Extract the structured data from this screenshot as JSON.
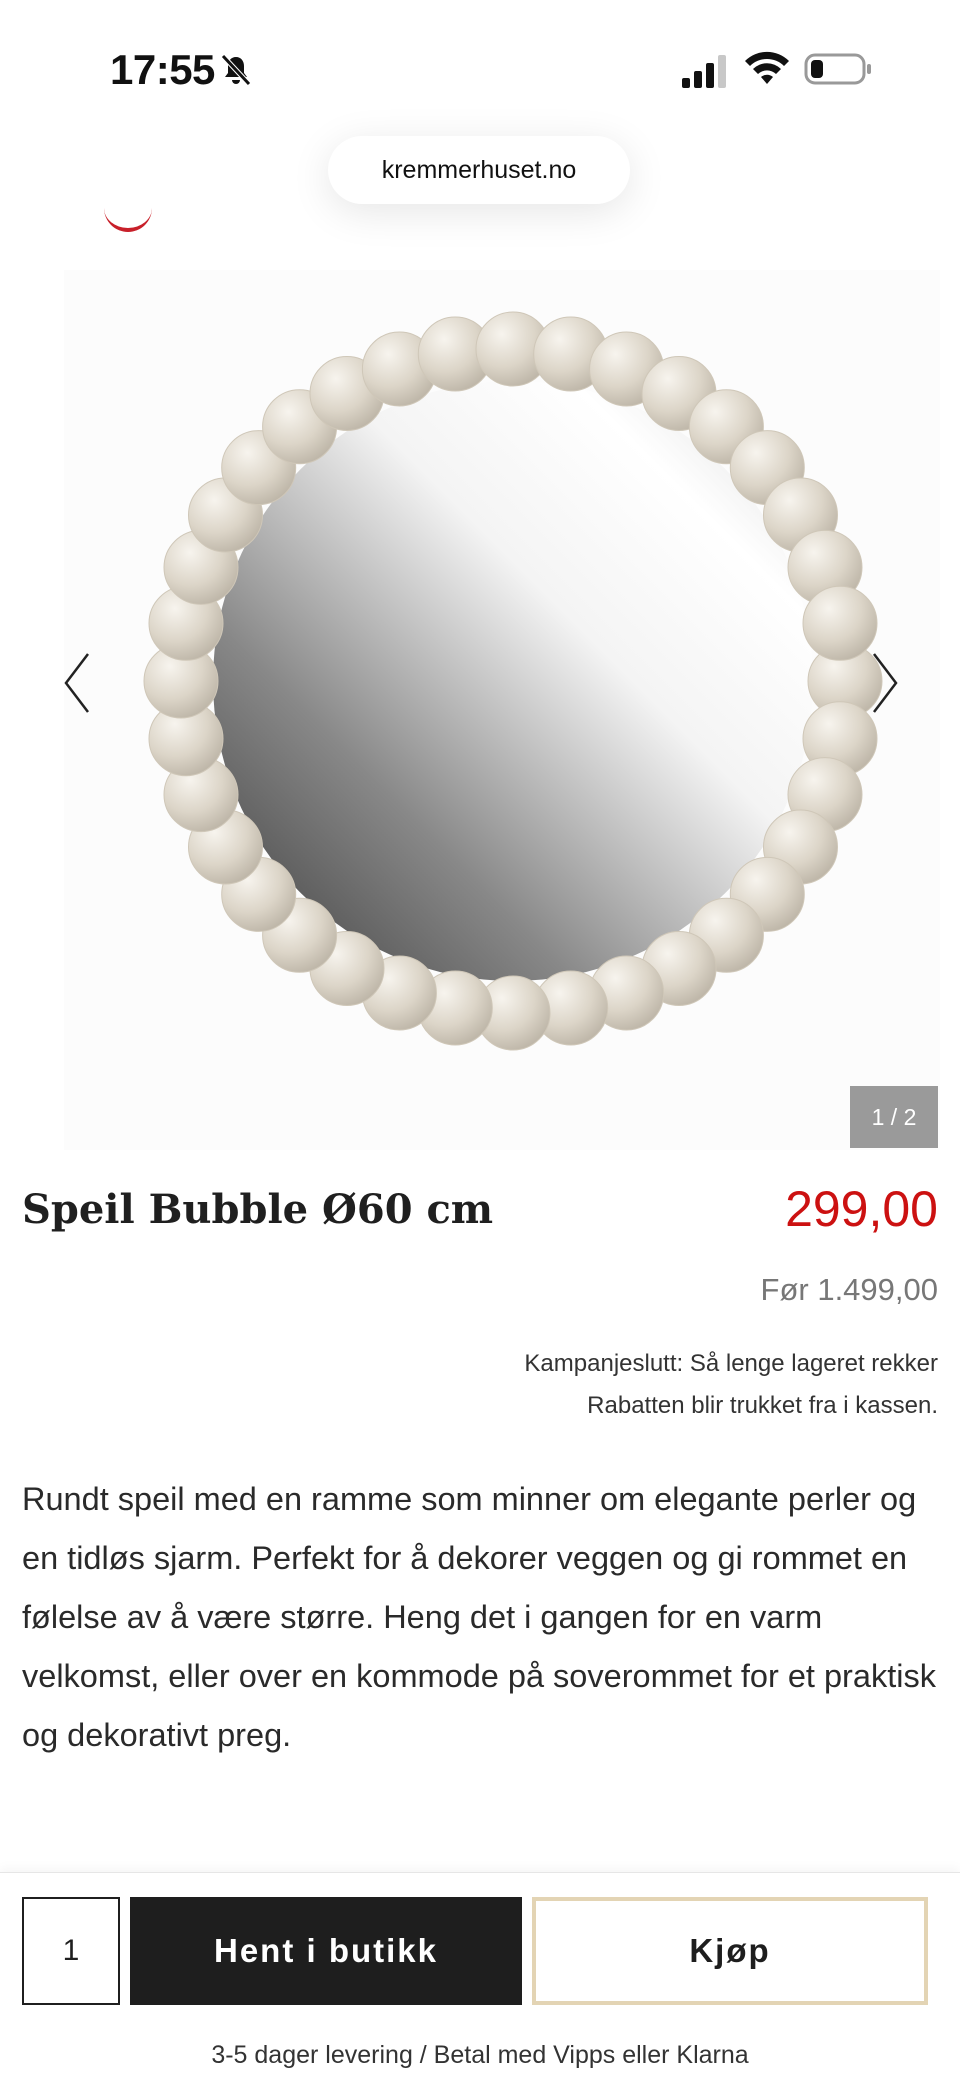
{
  "status_bar": {
    "time": "17:55",
    "icons": [
      "bell-slash-icon",
      "cellular-signal-icon",
      "wifi-icon",
      "battery-low-icon"
    ]
  },
  "browser": {
    "url": "kremmerhuset.no"
  },
  "gallery": {
    "counter": "1 / 2",
    "prev_icon": "chevron-left-icon",
    "next_icon": "chevron-right-icon"
  },
  "product": {
    "title": "Speil Bubble Ø60 cm",
    "price": "299,00",
    "old_price": "Før 1.499,00",
    "campaign": "Kampanjeslutt: Så lenge lageret rekker",
    "discount_note": "Rabatten blir trukket fra i kassen.",
    "description": "Rundt speil med en ramme som minner om elegante perler og en tidløs sjarm. Perfekt for å dekorer veggen og gi rommet en følelse av å være større. Heng det i gangen for en varm velkomst, eller over en kommode på soverommet for et praktisk og dekorativt preg."
  },
  "purchase_bar": {
    "quantity": "1",
    "store_button": "Hent i butikk",
    "buy_button": "Kjøp",
    "delivery_note": "3-5 dager levering / Betal med Vipps eller Klarna"
  },
  "colors": {
    "price_red": "#cc1111",
    "buy_border": "#e3d4b4",
    "store_button_bg": "#1e1e1e"
  }
}
